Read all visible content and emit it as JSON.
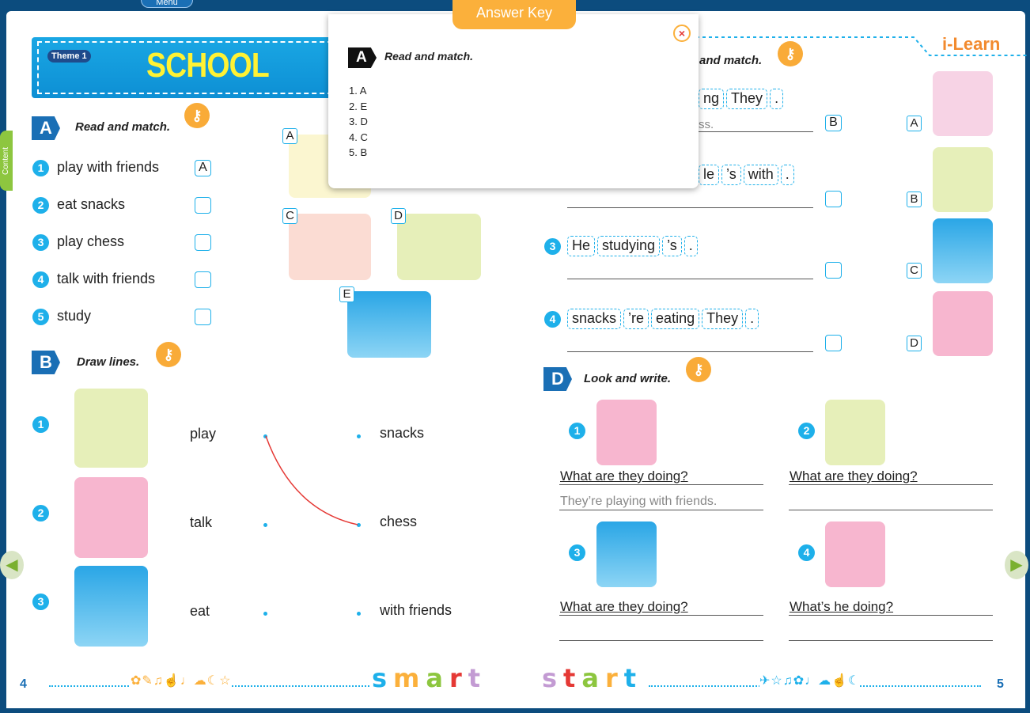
{
  "top": {
    "menu_label": "Menu",
    "content_tab": "Content"
  },
  "theme": {
    "pill": "Theme 1",
    "title": "SCHOOL"
  },
  "sectionA": {
    "badge": "A",
    "title": "Read and match.",
    "items": [
      {
        "n": "1",
        "text": "play with friends",
        "answer": "A"
      },
      {
        "n": "2",
        "text": "eat snacks",
        "answer": ""
      },
      {
        "n": "3",
        "text": "play chess",
        "answer": ""
      },
      {
        "n": "4",
        "text": "talk with friends",
        "answer": ""
      },
      {
        "n": "5",
        "text": "study",
        "answer": ""
      }
    ],
    "pictures": [
      "A",
      "B",
      "C",
      "D",
      "E"
    ]
  },
  "sectionB": {
    "badge": "B",
    "title": "Draw lines.",
    "rows": [
      {
        "n": "1",
        "left": "play",
        "right": "snacks"
      },
      {
        "n": "2",
        "left": "talk",
        "right": "chess"
      },
      {
        "n": "3",
        "left": "eat",
        "right": "with friends"
      }
    ]
  },
  "sectionC": {
    "title_visible": "and match.",
    "rows": [
      {
        "n": "1",
        "tiles": [
          "ng",
          "They",
          "."
        ],
        "answer_text": "ss.",
        "box": "B"
      },
      {
        "n": "2",
        "tiles": [
          "le",
          "’s",
          "with",
          "."
        ],
        "answer_text": "",
        "box": ""
      },
      {
        "n": "3",
        "tiles": [
          "He",
          "studying",
          "’s",
          "."
        ],
        "answer_text": "",
        "box": ""
      },
      {
        "n": "4",
        "tiles": [
          "snacks",
          "’re",
          "eating",
          "They",
          "."
        ],
        "answer_text": "",
        "box": ""
      }
    ],
    "pictures": [
      "A",
      "B",
      "C",
      "D"
    ]
  },
  "sectionD": {
    "badge": "D",
    "title": "Look and write.",
    "items": [
      {
        "n": "1",
        "question": "What are they doing?",
        "answer": "They’re playing with friends."
      },
      {
        "n": "2",
        "question": "What are they doing?",
        "answer": ""
      },
      {
        "n": "3",
        "question": "What are they doing?",
        "answer": ""
      },
      {
        "n": "4",
        "question": "What’s he doing?",
        "answer": ""
      }
    ]
  },
  "brand": "i-Learn",
  "footer": {
    "page_left": "4",
    "page_right": "5",
    "word1": [
      "s",
      "m",
      "a",
      "r",
      "t"
    ],
    "word2": [
      "s",
      "t",
      "a",
      "r",
      "t"
    ],
    "colors1": [
      "#1eb0ea",
      "#fbb03b",
      "#8dc63f",
      "#e53935",
      "#c39bd3"
    ],
    "colors2": [
      "#c39bd3",
      "#e53935",
      "#8dc63f",
      "#fbb03b",
      "#1eb0ea"
    ]
  },
  "answer_key": {
    "tab": "Answer Key",
    "badge": "A",
    "title": "Read and match.",
    "answers": [
      "1. A",
      "2. E",
      "3. D",
      "4. C",
      "5. B"
    ],
    "close": "×"
  },
  "nav": {
    "prev": "◀",
    "next": "▶"
  },
  "colors": {
    "accent": "#1eb0ea",
    "key": "#fbb03b",
    "brand_blue": "#1a6fb5"
  }
}
